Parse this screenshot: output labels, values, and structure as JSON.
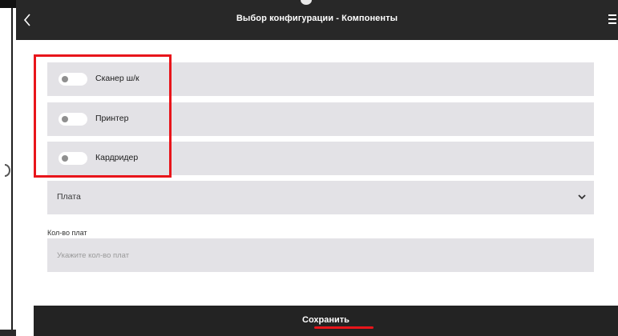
{
  "header": {
    "title": "Выбор конфигурации - Компоненты",
    "back_icon": "chevron-left-icon",
    "menu_icon": "hamburger-menu-icon"
  },
  "components": [
    {
      "label": "Сканер ш/к",
      "enabled": false
    },
    {
      "label": "Принтер",
      "enabled": false
    },
    {
      "label": "Кардридер",
      "enabled": false
    }
  ],
  "board_select": {
    "value": "Плата",
    "icon": "chevron-down-icon"
  },
  "board_count": {
    "label": "Кол-во плат",
    "placeholder": "Укажите кол-во плат",
    "value": ""
  },
  "footer": {
    "save_label": "Сохранить"
  },
  "colors": {
    "header_bg": "#282828",
    "row_bg": "#e3e2e6",
    "highlight": "#e8151b",
    "footer_bg": "#232323"
  }
}
